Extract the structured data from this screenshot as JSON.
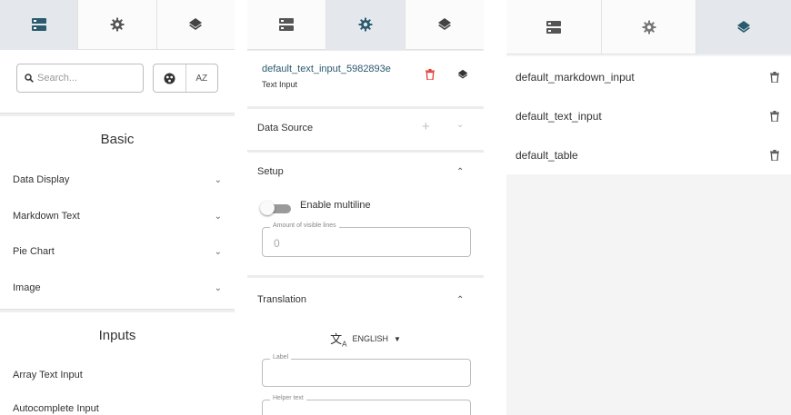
{
  "panels": [
    {
      "active_tab": "components"
    },
    {
      "active_tab": "settings"
    },
    {
      "active_tab": "layers"
    }
  ],
  "components_panel": {
    "search": {
      "placeholder": "Search..."
    },
    "sort_alpha_label": "AZ",
    "sections": [
      {
        "title": "Basic",
        "items": [
          "Data Display",
          "Markdown Text",
          "Pie Chart",
          "Image"
        ]
      },
      {
        "title": "Inputs",
        "items": [
          "Array Text Input",
          "Autocomplete Input"
        ]
      }
    ]
  },
  "settings_panel": {
    "component_name": "default_text_input_5982893e",
    "component_type": "Text Input",
    "data_source_label": "Data Source",
    "setup_label": "Setup",
    "enable_multiline_label": "Enable multiline",
    "visible_lines_label": "Amount of visible lines",
    "visible_lines_value": "0",
    "translation_label": "Translation",
    "language": "ENGLISH",
    "label_field_label": "Label",
    "helper_text_label": "Helper text"
  },
  "layers_panel": {
    "items": [
      "default_markdown_input",
      "default_text_input",
      "default_table"
    ]
  },
  "colors": {
    "accent": "#2a5a6e",
    "delete_red": "#e53935",
    "active_tab_bg": "#e4e8ec"
  }
}
